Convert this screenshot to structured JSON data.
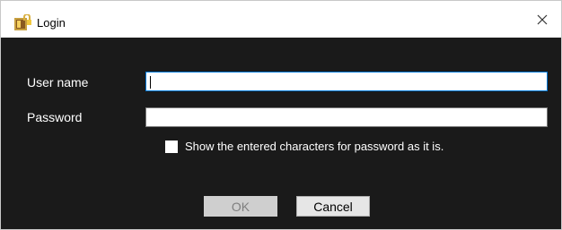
{
  "window": {
    "title": "Login",
    "app_icon": "padlock-app-icon",
    "close_icon": "close-icon"
  },
  "form": {
    "username_label": "User name",
    "username_value": "",
    "password_label": "Password",
    "password_value": "",
    "show_password_label": "Show the entered characters for password as it is.",
    "show_password_checked": false
  },
  "buttons": {
    "ok_label": "OK",
    "ok_enabled": false,
    "cancel_label": "Cancel"
  },
  "colors": {
    "background": "#1a1a1a",
    "titlebar": "#ffffff",
    "focus_border": "#0078d7",
    "text": "#ffffff"
  }
}
